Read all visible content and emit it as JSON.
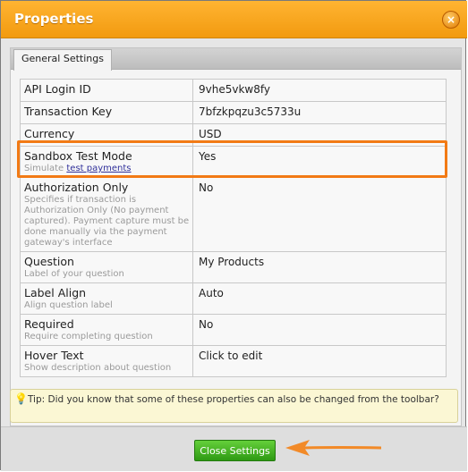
{
  "dialog": {
    "title": "Properties"
  },
  "tabs": [
    {
      "label": "General Settings",
      "active": true
    }
  ],
  "rows": [
    {
      "key": "API Login ID",
      "desc": "",
      "value": "9vhe5vkw8fy"
    },
    {
      "key": "Transaction Key",
      "desc": "",
      "value": "7bfzkpqzu3c5733u"
    },
    {
      "key": "Currency",
      "desc": "",
      "value": "USD"
    },
    {
      "key": "Sandbox Test Mode",
      "desc_prefix": "Simulate",
      "desc_link": "test payments",
      "value": "Yes",
      "highlighted": true
    },
    {
      "key": "Authorization Only",
      "desc": "Specifies if transaction is Authorization Only (No payment captured). Payment capture must be done manually via the payment gateway's interface",
      "value": "No"
    },
    {
      "key": "Question",
      "desc": "Label of your question",
      "value": "My Products"
    },
    {
      "key": "Label Align",
      "desc": "Align question label",
      "value": "Auto"
    },
    {
      "key": "Required",
      "desc": "Require completing question",
      "value": "No"
    },
    {
      "key": "Hover Text",
      "desc": "Show description about question",
      "value": "Click to edit"
    }
  ],
  "tip": {
    "text": "Tip: Did you know that some of these properties can also be changed from the toolbar?"
  },
  "footer": {
    "close_settings_label": "Close Settings"
  },
  "colors": {
    "titlebar": "#f5a31f",
    "highlight_border": "#f27a15",
    "button": "#3fae22",
    "arrow": "#f28a28"
  }
}
